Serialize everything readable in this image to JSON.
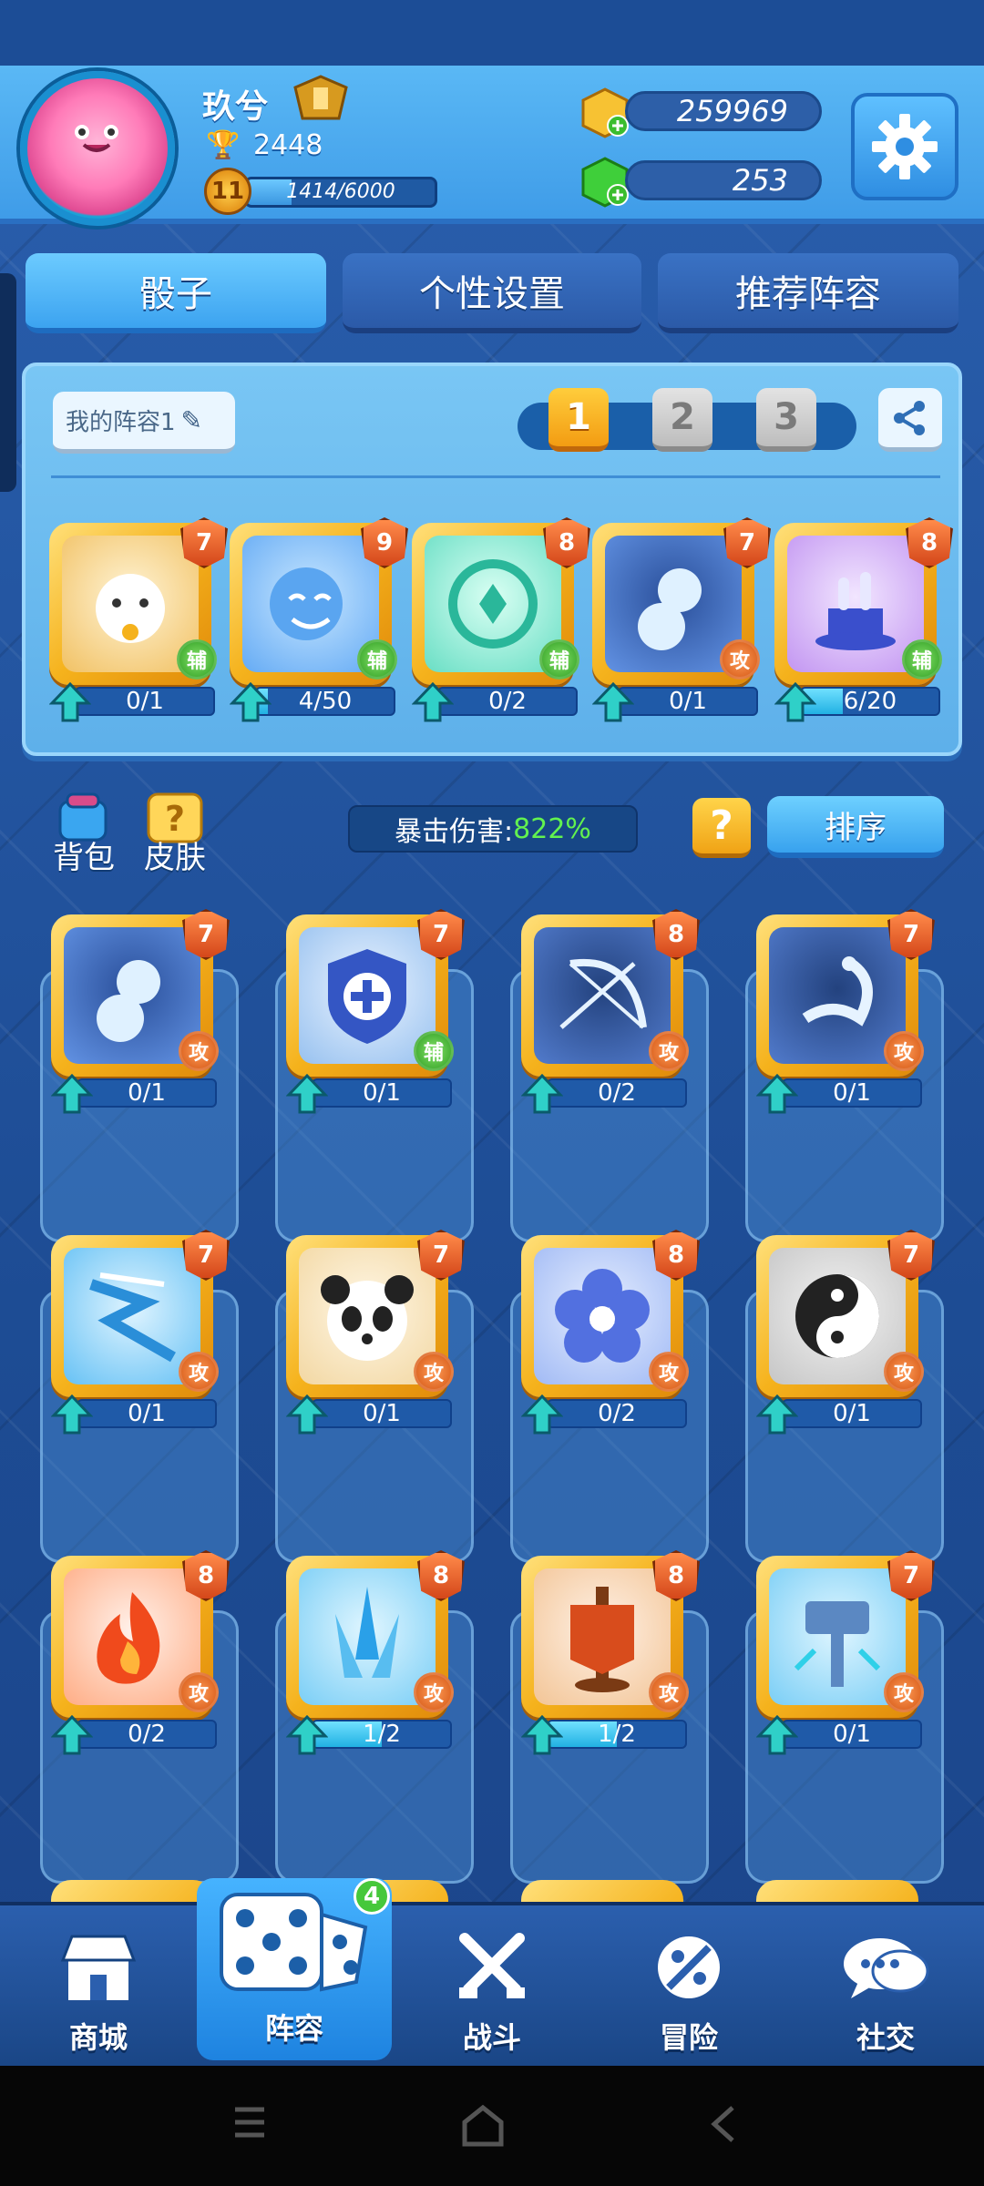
{
  "player": {
    "name": "玖兮",
    "trophies": "2448",
    "level": "11",
    "xp_text": "1414/6000",
    "xp_fraction": 0.236
  },
  "currency": {
    "gold": "259969",
    "gems": "253"
  },
  "tabs": [
    {
      "label": "骰子",
      "active": true
    },
    {
      "label": "个性设置",
      "active": false
    },
    {
      "label": "推荐阵容",
      "active": false
    }
  ],
  "deck": {
    "name_label": "我的阵容1",
    "slots": [
      "1",
      "2",
      "3"
    ],
    "active_slot": 0,
    "cards": [
      {
        "name": "lucky-cat-dice",
        "level": "7",
        "role": "辅",
        "role_type": "sup",
        "progress": "0/1",
        "fill": 0.0
      },
      {
        "name": "mask-dice",
        "level": "9",
        "role": "辅",
        "role_type": "sup",
        "progress": "4/50",
        "fill": 0.08
      },
      {
        "name": "wind-dice",
        "level": "8",
        "role": "辅",
        "role_type": "sup",
        "progress": "0/2",
        "fill": 0.0
      },
      {
        "name": "gourd-dice",
        "level": "7",
        "role": "攻",
        "role_type": "atk",
        "progress": "0/1",
        "fill": 0.0
      },
      {
        "name": "magic-hat-dice",
        "level": "8",
        "role": "辅",
        "role_type": "sup",
        "progress": "6/20",
        "fill": 0.3
      }
    ]
  },
  "stats": {
    "crit_label": "暴击伤害:",
    "crit_value": "822%"
  },
  "buttons": {
    "bag": "背包",
    "skin": "皮肤",
    "help": "?",
    "sort": "排序"
  },
  "collection": [
    {
      "name": "gourd-dice",
      "level": "7",
      "role": "攻",
      "role_type": "atk",
      "progress": "0/1",
      "fill": 0.0
    },
    {
      "name": "shield-dice",
      "level": "7",
      "role": "辅",
      "role_type": "sup",
      "progress": "0/1",
      "fill": 0.0
    },
    {
      "name": "bow-dice",
      "level": "8",
      "role": "攻",
      "role_type": "atk",
      "progress": "0/2",
      "fill": 0.0
    },
    {
      "name": "scorpion-dice",
      "level": "7",
      "role": "攻",
      "role_type": "atk",
      "progress": "0/1",
      "fill": 0.0
    },
    {
      "name": "lightning-dice",
      "level": "7",
      "role": "攻",
      "role_type": "atk",
      "progress": "0/1",
      "fill": 0.0
    },
    {
      "name": "panda-dice",
      "level": "7",
      "role": "攻",
      "role_type": "atk",
      "progress": "0/1",
      "fill": 0.0
    },
    {
      "name": "flower-dice",
      "level": "8",
      "role": "攻",
      "role_type": "atk",
      "progress": "0/2",
      "fill": 0.0
    },
    {
      "name": "yin-yang-dice",
      "level": "7",
      "role": "攻",
      "role_type": "atk",
      "progress": "0/1",
      "fill": 0.0
    },
    {
      "name": "fire-dice",
      "level": "8",
      "role": "攻",
      "role_type": "atk",
      "progress": "0/2",
      "fill": 0.0
    },
    {
      "name": "ice-spike-dice",
      "level": "8",
      "role": "攻",
      "role_type": "atk",
      "progress": "1/2",
      "fill": 0.5
    },
    {
      "name": "banner-dice",
      "level": "8",
      "role": "攻",
      "role_type": "atk",
      "progress": "1/2",
      "fill": 0.5
    },
    {
      "name": "hammer-dice",
      "level": "7",
      "role": "攻",
      "role_type": "atk",
      "progress": "0/1",
      "fill": 0.0
    }
  ],
  "nav": [
    {
      "label": "商城",
      "icon": "shop-icon"
    },
    {
      "label": "阵容",
      "icon": "dice-icon",
      "badge": "4",
      "active": true
    },
    {
      "label": "战斗",
      "icon": "crossed-swords-icon"
    },
    {
      "label": "冒险",
      "icon": "adventure-icon"
    },
    {
      "label": "社交",
      "icon": "chat-icon"
    }
  ],
  "colors": {
    "gold_frame": "#f5b21c",
    "accent_blue": "#3ca3f0",
    "crit_green": "#62f24f",
    "attack_orange": "#d35512",
    "support_green": "#2e9d22"
  }
}
